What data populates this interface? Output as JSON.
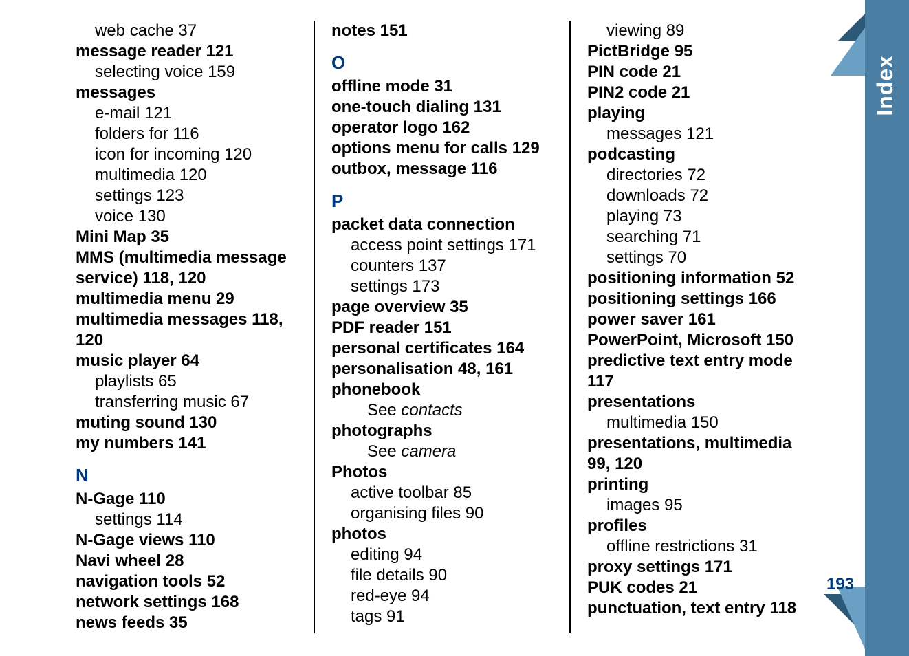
{
  "side_tab": "Index",
  "page_number": "193",
  "letters": {
    "N": "N",
    "O": "O",
    "P": "P"
  },
  "col1": [
    {
      "cls": "entry sub",
      "t": "web cache    37"
    },
    {
      "cls": "entry bold",
      "t": "message reader    121"
    },
    {
      "cls": "entry sub",
      "t": "selecting voice    159"
    },
    {
      "cls": "entry bold",
      "t": "messages"
    },
    {
      "cls": "entry sub",
      "t": "e-mail    121"
    },
    {
      "cls": "entry sub",
      "t": "folders for    116"
    },
    {
      "cls": "entry sub",
      "t": "icon for incoming    120"
    },
    {
      "cls": "entry sub",
      "t": "multimedia    120"
    },
    {
      "cls": "entry sub",
      "t": "settings    123"
    },
    {
      "cls": "entry sub",
      "t": "voice    130"
    },
    {
      "cls": "entry bold",
      "t": "Mini Map    35"
    },
    {
      "cls": "entry bold",
      "t": "MMS (multimedia message service)    118, 120"
    },
    {
      "cls": "entry bold",
      "t": "multimedia menu    29"
    },
    {
      "cls": "entry bold",
      "t": "multimedia messages    118, 120"
    },
    {
      "cls": "entry bold",
      "t": "music player    64"
    },
    {
      "cls": "entry sub",
      "t": "playlists    65"
    },
    {
      "cls": "entry sub",
      "t": "transferring music    67"
    },
    {
      "cls": "entry bold",
      "t": "muting sound    130"
    },
    {
      "cls": "entry bold",
      "t": "my numbers    141"
    }
  ],
  "col1_N": [
    {
      "cls": "entry bold",
      "t": "N-Gage    110"
    },
    {
      "cls": "entry sub",
      "t": "settings    114"
    },
    {
      "cls": "entry bold",
      "t": "N-Gage views    110"
    },
    {
      "cls": "entry bold",
      "t": "Navi wheel    28"
    },
    {
      "cls": "entry bold",
      "t": "navigation tools    52"
    },
    {
      "cls": "entry bold",
      "t": "network settings    168"
    },
    {
      "cls": "entry bold",
      "t": "news feeds    35"
    }
  ],
  "col2_top": [
    {
      "cls": "entry bold",
      "t": "notes    151"
    }
  ],
  "col2_O": [
    {
      "cls": "entry bold",
      "t": "offline mode    31"
    },
    {
      "cls": "entry bold",
      "t": "one-touch dialing    131"
    },
    {
      "cls": "entry bold",
      "t": "operator logo    162"
    },
    {
      "cls": "entry bold",
      "t": "options menu for calls    129"
    },
    {
      "cls": "entry bold",
      "t": "outbox, message    116"
    }
  ],
  "col2_P": [
    {
      "cls": "entry bold",
      "t": "packet data connection"
    },
    {
      "cls": "entry sub",
      "t": "access point settings    171"
    },
    {
      "cls": "entry sub",
      "t": "counters    137"
    },
    {
      "cls": "entry sub",
      "t": "settings    173"
    },
    {
      "cls": "entry bold",
      "t": "page overview    35"
    },
    {
      "cls": "entry bold",
      "t": "PDF reader    151"
    },
    {
      "cls": "entry bold",
      "t": "personal certificates    164"
    },
    {
      "cls": "entry bold",
      "t": "personalisation    48, 161"
    },
    {
      "cls": "entry bold",
      "t": "phonebook"
    },
    {
      "cls": "entry seealso",
      "html": "See <span class='ital'>contacts</span>"
    },
    {
      "cls": "entry bold",
      "t": "photographs"
    },
    {
      "cls": "entry seealso",
      "html": "See <span class='ital'>camera</span>"
    },
    {
      "cls": "entry bold",
      "t": "Photos"
    },
    {
      "cls": "entry sub",
      "t": "active toolbar    85"
    },
    {
      "cls": "entry sub",
      "t": "organising files    90"
    },
    {
      "cls": "entry bold",
      "t": "photos"
    },
    {
      "cls": "entry sub",
      "t": "editing    94"
    },
    {
      "cls": "entry sub",
      "t": "file details    90"
    },
    {
      "cls": "entry sub",
      "t": "red-eye    94"
    },
    {
      "cls": "entry sub",
      "t": "tags    91"
    }
  ],
  "col3": [
    {
      "cls": "entry sub",
      "t": "viewing    89"
    },
    {
      "cls": "entry bold",
      "t": "PictBridge    95"
    },
    {
      "cls": "entry bold",
      "t": "PIN code    21"
    },
    {
      "cls": "entry bold",
      "t": "PIN2 code    21"
    },
    {
      "cls": "entry bold",
      "t": "playing"
    },
    {
      "cls": "entry sub",
      "t": "messages    121"
    },
    {
      "cls": "entry bold",
      "t": "podcasting"
    },
    {
      "cls": "entry sub",
      "t": "directories    72"
    },
    {
      "cls": "entry sub",
      "t": "downloads    72"
    },
    {
      "cls": "entry sub",
      "t": "playing    73"
    },
    {
      "cls": "entry sub",
      "t": "searching    71"
    },
    {
      "cls": "entry sub",
      "t": "settings    70"
    },
    {
      "cls": "entry bold",
      "t": "positioning information    52"
    },
    {
      "cls": "entry bold",
      "t": "positioning settings    166"
    },
    {
      "cls": "entry bold",
      "t": "power saver    161"
    },
    {
      "cls": "entry bold",
      "t": "PowerPoint, Microsoft    150"
    },
    {
      "cls": "entry bold",
      "t": "predictive text entry mode    117"
    },
    {
      "cls": "entry bold",
      "t": "presentations"
    },
    {
      "cls": "entry sub",
      "t": "multimedia    150"
    },
    {
      "cls": "entry bold",
      "t": "presentations, multimedia    99, 120"
    },
    {
      "cls": "entry bold",
      "t": "printing"
    },
    {
      "cls": "entry sub",
      "t": "images    95"
    },
    {
      "cls": "entry bold",
      "t": "profiles"
    },
    {
      "cls": "entry sub",
      "t": "offline restrictions    31"
    },
    {
      "cls": "entry bold",
      "t": "proxy settings    171"
    },
    {
      "cls": "entry bold",
      "t": "PUK codes    21"
    },
    {
      "cls": "entry bold",
      "t": "punctuation, text entry    118"
    }
  ]
}
